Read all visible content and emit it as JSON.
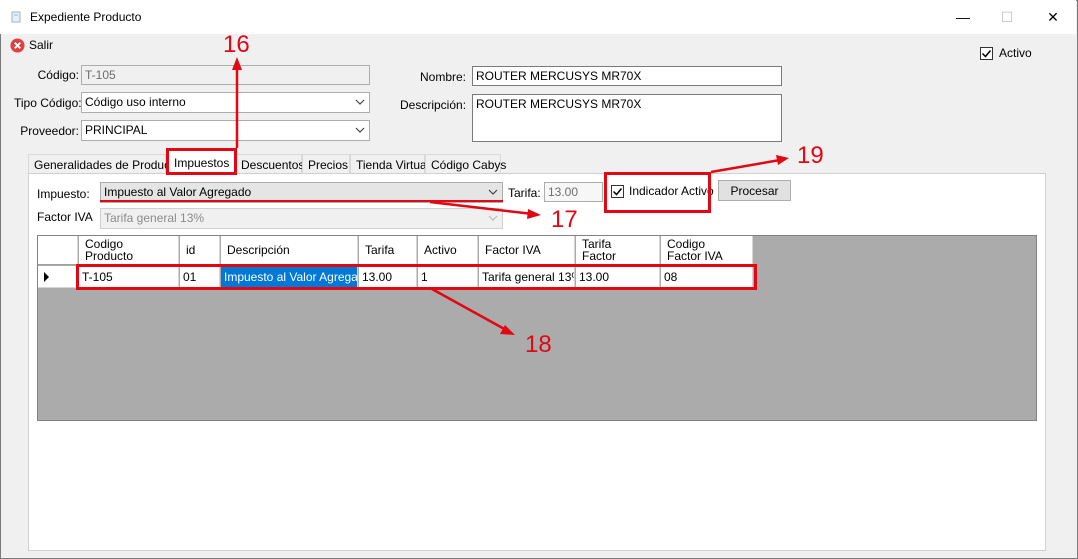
{
  "window": {
    "title": "Expediente Producto",
    "minimize_glyph": "—",
    "maximize_glyph": "☐",
    "close_glyph": "✕"
  },
  "toolbar": {
    "exit_label": "Salir"
  },
  "form": {
    "active_label": "Activo",
    "active_checked": true,
    "codigo_label": "Código:",
    "codigo_value": "T-105",
    "tipo_codigo_label": "Tipo Código:",
    "tipo_codigo_value": "Código uso interno",
    "proveedor_label": "Proveedor:",
    "proveedor_value": "PRINCIPAL",
    "nombre_label": "Nombre:",
    "nombre_value": "ROUTER MERCUSYS MR70X",
    "descripcion_label": "Descripción:",
    "descripcion_value": "ROUTER MERCUSYS MR70X"
  },
  "tabs": [
    {
      "label": "Generalidades de Producto"
    },
    {
      "label": "Impuestos"
    },
    {
      "label": "Descuentos"
    },
    {
      "label": "Precios"
    },
    {
      "label": "Tienda Virtual"
    },
    {
      "label": "Código Cabys"
    }
  ],
  "impuestos": {
    "impuesto_label": "Impuesto:",
    "impuesto_value": "Impuesto al Valor Agregado",
    "tarifa_label": "Tarifa:",
    "tarifa_value": "13.00",
    "indicador_label": "Indicador Activo",
    "indicador_checked": true,
    "procesar_label": "Procesar",
    "factor_iva_label": "Factor IVA",
    "factor_iva_value": "Tarifa general 13%"
  },
  "grid": {
    "columns": [
      "Codigo\nProducto",
      "id",
      "Descripción",
      "Tarifa",
      "Activo",
      "Factor IVA",
      "Tarifa\nFactor",
      "Codigo\nFactor IVA"
    ],
    "rows": [
      [
        "T-105",
        "01",
        "Impuesto al Valor Agregado",
        "13.00",
        "1",
        "Tarifa general 13%",
        "13.00",
        "08"
      ]
    ]
  },
  "annotations": [
    "16",
    "17",
    "18",
    "19"
  ],
  "colors": {
    "annotation": "#e30613",
    "selection": "#0078d7",
    "grid_bg": "#ababab"
  }
}
